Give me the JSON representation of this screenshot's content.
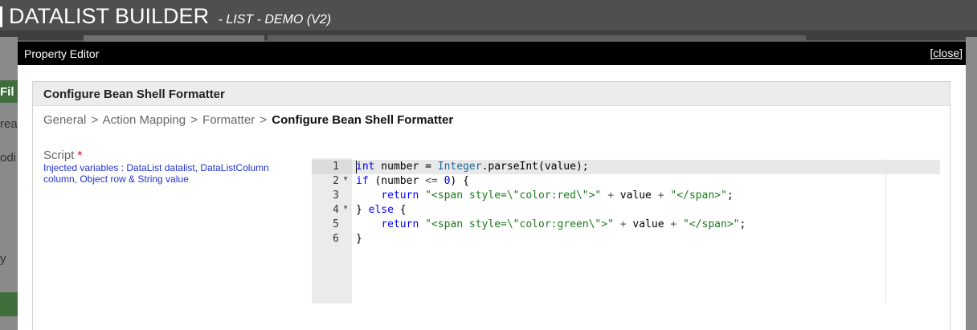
{
  "app": {
    "title": "DATALIST BUILDER",
    "subtitle": "- LIST - DEMO (V2)",
    "side_fragments": [
      "Fil",
      "rea",
      "odi",
      "y"
    ]
  },
  "dialog": {
    "title": "Property Editor",
    "close_label": "[close]",
    "panel_title": "Configure Bean Shell Formatter",
    "breadcrumb": {
      "items": [
        "General",
        "Action Mapping",
        "Formatter"
      ],
      "separator": ">",
      "current": "Configure Bean Shell Formatter"
    },
    "field": {
      "label": "Script",
      "required_mark": "*",
      "hint": "Injected variables : DataList datalist, DataListColumn column, Object row & String value"
    },
    "editor": {
      "line_numbers": [
        "1",
        "2",
        "3",
        "4",
        "5",
        "6"
      ],
      "foldable_lines": [
        2,
        4
      ],
      "active_line": 1,
      "code": [
        "int number = Integer.parseInt(value);",
        "if (number <= 0) {",
        "    return \"<span style=\\\"color:red\\\">\" + value + \"</span>\";",
        "} else {",
        "    return \"<span style=\\\"color:green\\\">\" + value + \"</span>\";",
        "}"
      ]
    }
  },
  "colors": {
    "titlebar": "#000000",
    "keyword": "#0000ff",
    "string": "#1a7a1a",
    "hint_text": "#2233cc",
    "required": "#dd0000"
  }
}
